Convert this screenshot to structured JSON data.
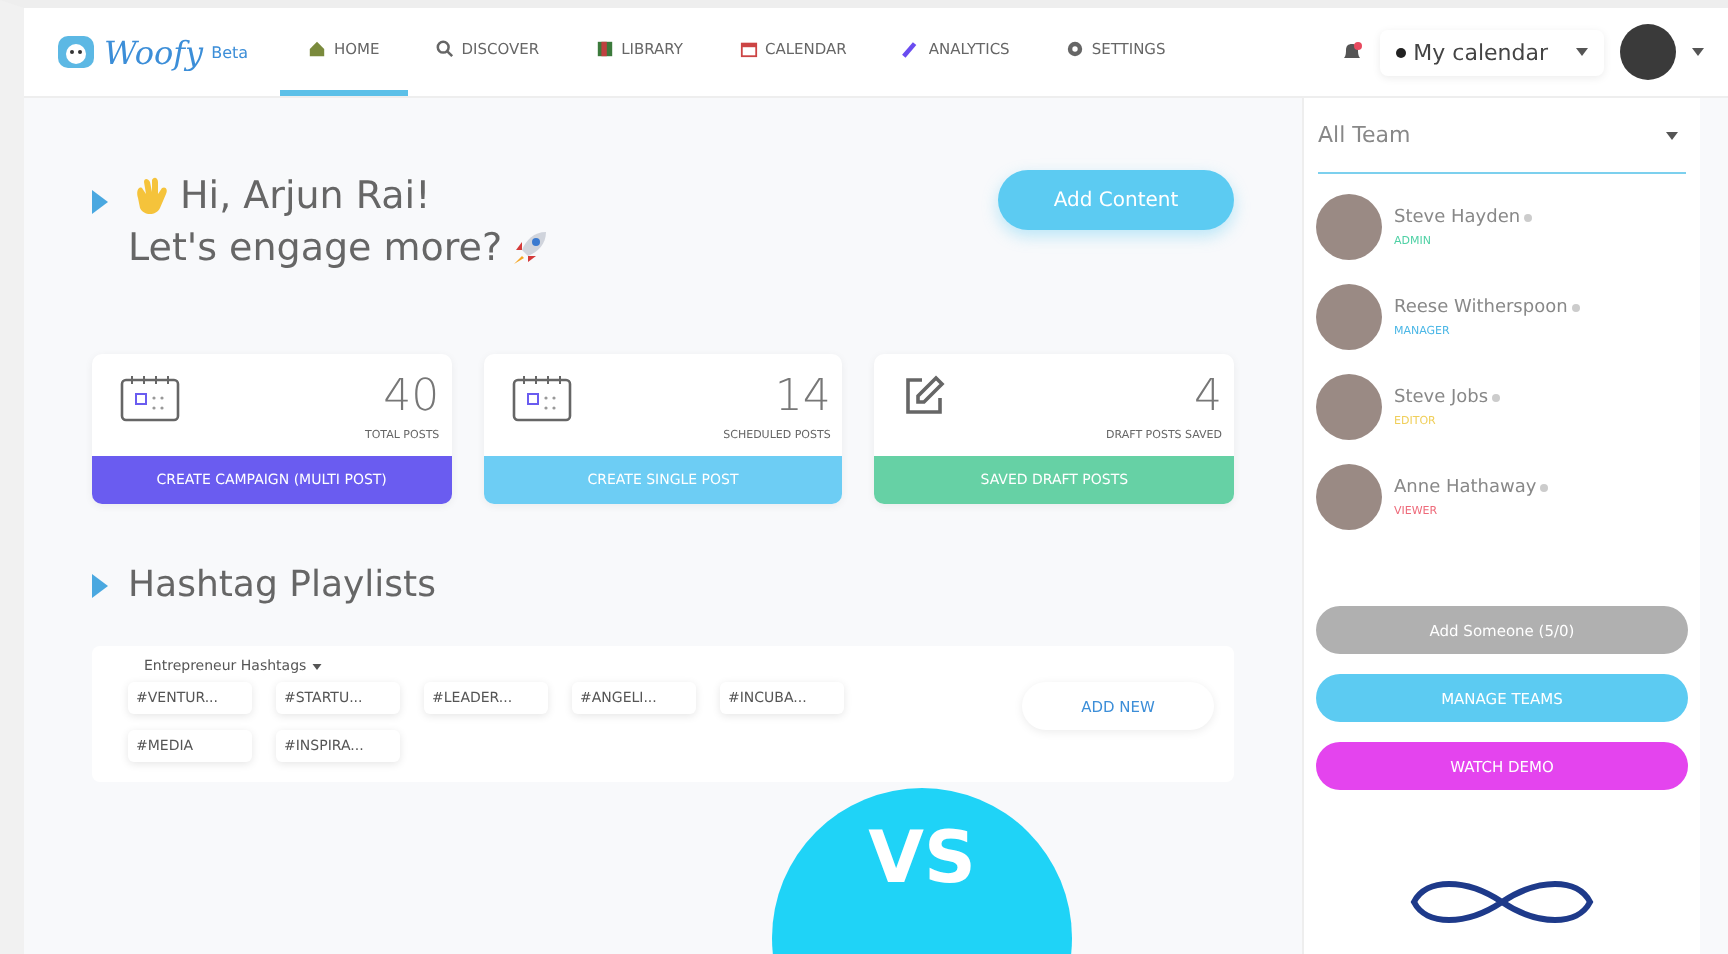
{
  "brand": {
    "name": "Woofy",
    "badge": "Beta"
  },
  "nav": [
    {
      "label": "HOME",
      "selected": true
    },
    {
      "label": "DISCOVER",
      "selected": false
    },
    {
      "label": "LIBRARY",
      "selected": false
    },
    {
      "label": "CALENDAR",
      "selected": false
    },
    {
      "label": "ANALYTICS",
      "selected": false
    },
    {
      "label": "SETTINGS",
      "selected": false
    }
  ],
  "calendar_select": {
    "value": "My calendar"
  },
  "greeting": {
    "line1": "Hi, Arjun Rai!",
    "line2": "Let's engage more?"
  },
  "add_content": "Add Content",
  "stats": [
    {
      "value": "40",
      "label": "TOTAL POSTS",
      "action": "CREATE CAMPAIGN (MULTI POST)",
      "color": "#6a5cf0"
    },
    {
      "value": "14",
      "label": "SCHEDULED POSTS",
      "action": "CREATE SINGLE POST",
      "color": "#6dcdf4"
    },
    {
      "value": "4",
      "label": "DRAFT POSTS SAVED",
      "action": "SAVED DRAFT POSTS",
      "color": "#66d1a5"
    }
  ],
  "playlists": {
    "title": "Hashtag Playlists",
    "dropdown": "Entrepreneur Hashtags",
    "add_new": "ADD NEW",
    "tags": [
      "#VENTUR...",
      "#STARTU...",
      "#LEADER...",
      "#ANGELI...",
      "#INCUBA...",
      "#MEDIA",
      "#INSPIRA..."
    ]
  },
  "team": {
    "filter": "All Team",
    "members": [
      {
        "name": "Steve Hayden",
        "role": "ADMIN",
        "color": "#4fd1a5"
      },
      {
        "name": "Reese Witherspoon",
        "role": "MANAGER",
        "color": "#4bb7e6"
      },
      {
        "name": "Steve Jobs",
        "role": "EDITOR",
        "color": "#f0cf5a"
      },
      {
        "name": "Anne Hathaway",
        "role": "VIEWER",
        "color": "#ee6a7a"
      }
    ],
    "buttons": [
      {
        "label": "Add Someone (5/0)",
        "disabled": true
      },
      {
        "label": "MANAGE TEAMS",
        "disabled": false,
        "color": "#5ccbf2"
      },
      {
        "label": "WATCH DEMO",
        "disabled": false,
        "color": "#e444ee"
      }
    ]
  },
  "overlay": {
    "text": "VS"
  }
}
